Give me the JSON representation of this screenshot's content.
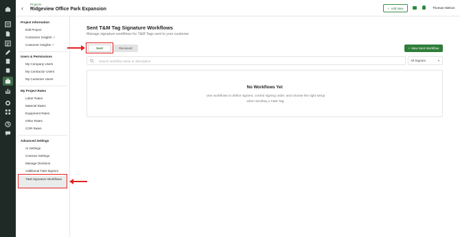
{
  "header": {
    "breadcrumb": "Projects",
    "project_title": "Ridgeview Office Park Expansion",
    "add_new_label": "Add New",
    "user_name": "Thomas Nielson"
  },
  "sidebar": {
    "sections": [
      {
        "title": "Project Information",
        "items": [
          "Edit Project",
          "Contractor Insights",
          "Customer Insights"
        ]
      },
      {
        "title": "Users & Permissions",
        "items": [
          "My Company Users",
          "My Contractor Users",
          "My Customer Users"
        ]
      },
      {
        "title": "My Project Rates",
        "items": [
          "Labor Rates",
          "Material Rates",
          "Equipment Rates",
          "Other Rates",
          "COR Rates"
        ]
      },
      {
        "title": "Advanced Settings",
        "items": [
          "AI Settings",
          "Contract Settings",
          "Manage Divisions",
          "Additional T&M Signers",
          "T&M Signature Workflows"
        ]
      }
    ],
    "external_link_glyph": "↗"
  },
  "main": {
    "title": "Sent T&M Tag Signature Workflows",
    "subtitle": "Manage signature workflows for T&M Tags sent to your customer",
    "tabs": {
      "sent": "Sent",
      "received": "Received"
    },
    "new_button_label": "New Sent Workflow",
    "search": {
      "placeholder": "Search workflow name or description",
      "value": ""
    },
    "signers_filter": "All Signers",
    "empty": {
      "title": "No Workflows Yet",
      "text": "Use workflows to define signers, control signing order, and choose the right setup when sending a T&M Tag."
    }
  },
  "colors": {
    "rail": "#1f2a26",
    "accent_green": "#2f7d3a",
    "annotation_red": "#e02020"
  },
  "icons": {
    "rail": [
      "dashboard-icon",
      "list-icon",
      "document-icon",
      "pencil-icon",
      "clipboard-icon",
      "receipt-icon",
      "briefcase-icon",
      "chart-icon",
      "gear-icon",
      "grid-icon",
      "help-icon",
      "chat-icon"
    ]
  }
}
